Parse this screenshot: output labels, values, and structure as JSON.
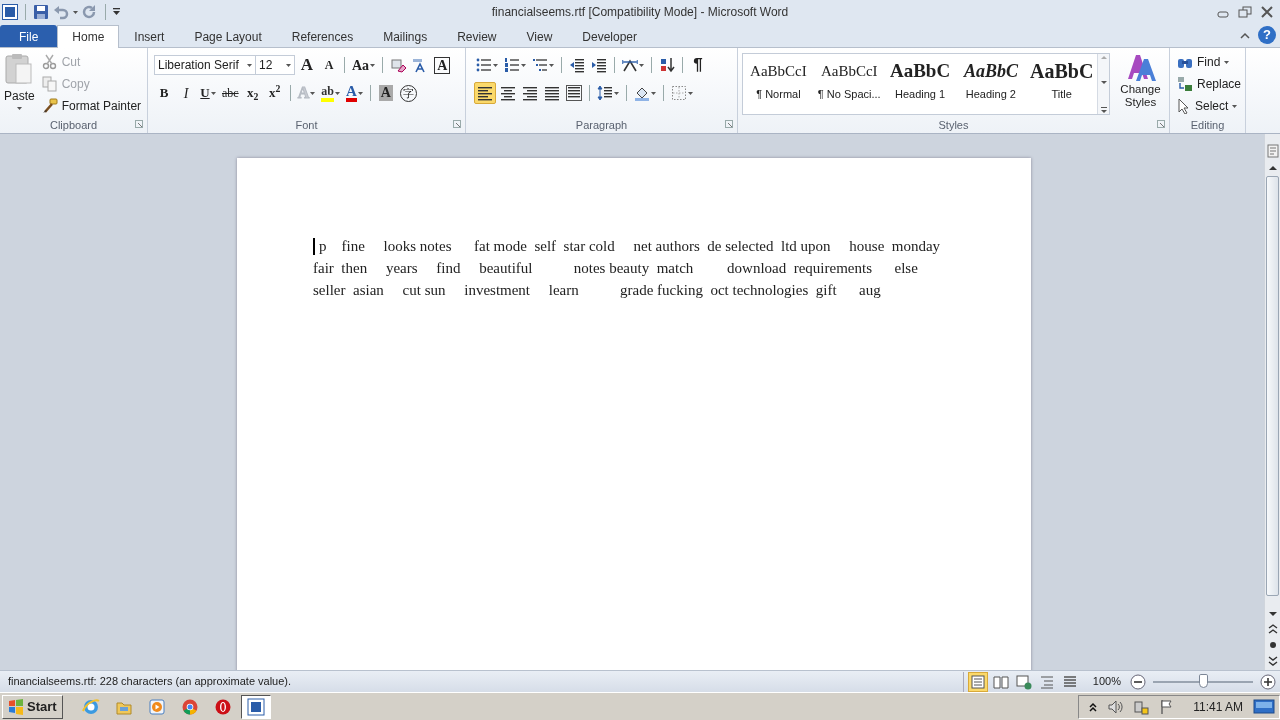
{
  "window": {
    "title": "financialseems.rtf [Compatibility Mode]  -  Microsoft Word"
  },
  "tabs": [
    {
      "label": "File",
      "kind": "file",
      "selected": false
    },
    {
      "label": "Home",
      "kind": "tab",
      "selected": true
    },
    {
      "label": "Insert",
      "kind": "tab",
      "selected": false
    },
    {
      "label": "Page Layout",
      "kind": "tab",
      "selected": false
    },
    {
      "label": "References",
      "kind": "tab",
      "selected": false
    },
    {
      "label": "Mailings",
      "kind": "tab",
      "selected": false
    },
    {
      "label": "Review",
      "kind": "tab",
      "selected": false
    },
    {
      "label": "View",
      "kind": "tab",
      "selected": false
    },
    {
      "label": "Developer",
      "kind": "tab",
      "selected": false
    }
  ],
  "help": "?",
  "clipboard": {
    "label": "Clipboard",
    "paste": "Paste",
    "actions": [
      {
        "label": "Cut",
        "kind": "cut",
        "disabled": true
      },
      {
        "label": "Copy",
        "kind": "copy",
        "disabled": true
      },
      {
        "label": "Format Painter",
        "kind": "painter",
        "disabled": false
      }
    ]
  },
  "font": {
    "label": "Font",
    "name": "Liberation Serif",
    "size": "12",
    "row1": [
      {
        "kind": "grow",
        "label": "A"
      },
      {
        "kind": "shrink",
        "label": "A"
      },
      {
        "kind": "case",
        "label": "Aa"
      },
      {
        "kind": "clear"
      },
      {
        "kind": "phonetic"
      },
      {
        "kind": "boxed",
        "label": "A"
      }
    ],
    "row2": [
      {
        "kind": "bold",
        "label": "B"
      },
      {
        "kind": "italic",
        "label": "I"
      },
      {
        "kind": "underline",
        "label": "U"
      },
      {
        "kind": "strike",
        "label": "abc"
      },
      {
        "kind": "sub",
        "label": "x$_{2}$"
      },
      {
        "kind": "sup",
        "label": "x$^{2}$"
      },
      {
        "kind": "effects",
        "label": "A"
      },
      {
        "kind": "highlight",
        "label": "ab",
        "color": "#ffff00"
      },
      {
        "kind": "color",
        "label": "A",
        "color": "#e00000"
      },
      {
        "kind": "shading",
        "label": "A"
      },
      {
        "kind": "enclose",
        "label": "字"
      }
    ]
  },
  "paragraph": {
    "label": "Paragraph",
    "row1": [
      {
        "kind": "bullets"
      },
      {
        "kind": "numbering"
      },
      {
        "kind": "multilevel"
      },
      {
        "kind": "outdent"
      },
      {
        "kind": "indent"
      },
      {
        "kind": "asian"
      },
      {
        "kind": "sort"
      },
      {
        "kind": "marks",
        "label": "¶"
      }
    ],
    "alignment": [
      {
        "kind": "left",
        "selected": true
      },
      {
        "kind": "center",
        "selected": false
      },
      {
        "kind": "right",
        "selected": false
      },
      {
        "kind": "justify",
        "selected": false
      },
      {
        "kind": "distributed",
        "selected": false
      }
    ],
    "row2": [
      {
        "kind": "spacing"
      },
      {
        "kind": "fill"
      },
      {
        "kind": "borders"
      }
    ]
  },
  "styles": {
    "label": "Styles",
    "change_styles": "Change Styles",
    "items": [
      {
        "kind": "normal",
        "preview": "AaBbCcI",
        "name": "¶ Normal"
      },
      {
        "kind": "normal",
        "preview": "AaBbCcI",
        "name": "¶ No Spaci..."
      },
      {
        "kind": "heading1",
        "preview": "AaBbC",
        "name": "Heading 1"
      },
      {
        "kind": "heading2",
        "preview": "AaBbC",
        "name": "Heading 2"
      },
      {
        "kind": "title",
        "preview": "AaBbC",
        "name": "Title"
      }
    ]
  },
  "editing": {
    "label": "Editing",
    "find": "Find",
    "replace": "Replace",
    "select": "Select"
  },
  "document": {
    "lines": [
      "p    fine     looks notes      fat mode  self  star cold     net authors  de selected  ltd upon     house  monday",
      "fair  then     years     find     beautiful           notes beauty  match         download  requirements      else",
      "seller  asian     cut sun     investment     learn           grade fucking  oct technologies  gift      aug"
    ]
  },
  "status_bar": {
    "text": "financialseems.rtf: 228 characters (an approximate value).",
    "views": [
      {
        "kind": "print",
        "selected": true
      },
      {
        "kind": "reading",
        "selected": false
      },
      {
        "kind": "web",
        "selected": false
      },
      {
        "kind": "outline",
        "selected": false
      },
      {
        "kind": "draft",
        "selected": false
      }
    ],
    "zoom": "100%",
    "zoom_slider": {
      "level": 0.5
    }
  },
  "taskbar": {
    "start": "Start",
    "apps": [
      {
        "kind": "browser",
        "selected": false
      },
      {
        "kind": "folder",
        "selected": false
      },
      {
        "kind": "media",
        "selected": false
      },
      {
        "kind": "chrome",
        "selected": false
      },
      {
        "kind": "opera",
        "selected": false
      },
      {
        "kind": "word",
        "selected": true
      }
    ],
    "clock": "11:41 AM"
  }
}
